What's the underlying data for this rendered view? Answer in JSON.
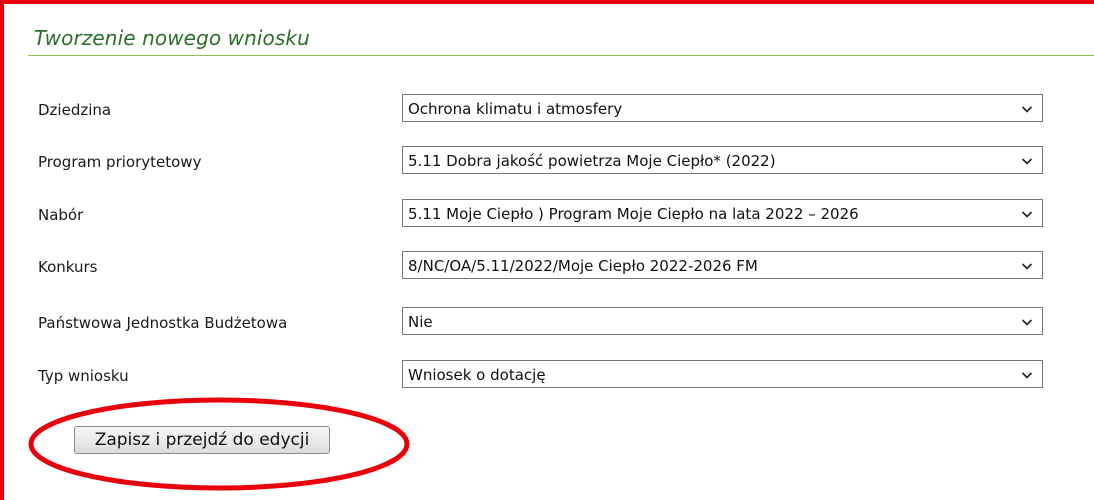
{
  "panel": {
    "title": "Tworzenie nowego wniosku"
  },
  "form": {
    "fields": [
      {
        "label": "Dziedzina",
        "value": "Ochrona klimatu i atmosfery"
      },
      {
        "label": "Program priorytetowy",
        "value": "5.11 Dobra jakość powietrza Moje Ciepło* (2022)"
      },
      {
        "label": "Nabór",
        "value": "5.11 Moje Ciepło ) Program Moje Ciepło na lata 2022 – 2026"
      },
      {
        "label": "Konkurs",
        "value": "8/NC/OA/5.11/2022/Moje Ciepło 2022-2026 FM"
      },
      {
        "label": "Państwowa Jednostka Budżetowa",
        "value": "Nie"
      },
      {
        "label": "Typ wniosku",
        "value": "Wniosek o dotację"
      }
    ],
    "submit_label": "Zapisz i przejdź do edycji"
  },
  "icons": {
    "select_arrow": "chevron-down-icon"
  },
  "colors": {
    "title_text": "#2c6e2c",
    "title_rule": "#86c04e",
    "annotation": "#e8000b"
  }
}
